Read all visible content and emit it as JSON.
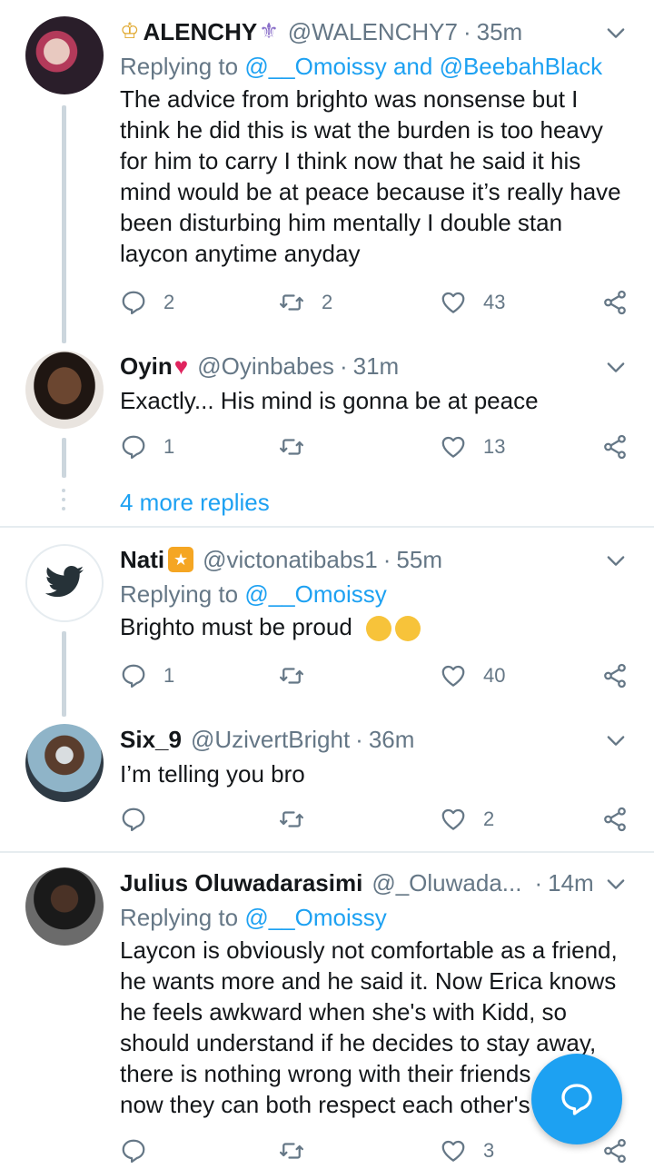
{
  "tweets": [
    {
      "name": "ALENCHY",
      "handle": "@WALENCHY7",
      "time": "35m",
      "replying_prefix": "Replying to ",
      "replying_mentions": "@__Omoissy and @BeebahBlack",
      "text": "The advice from brighto was nonsense but I think he did this is wat the burden is too heavy for him to carry I think now that he said it his mind would be at peace because it’s really have been disturbing him mentally I double stan laycon anytime anyday",
      "replies": "2",
      "retweets": "2",
      "likes": "43"
    },
    {
      "name": "Oyin",
      "handle": "@Oyinbabes",
      "time": "31m",
      "text": "Exactly... His mind is gonna be at peace",
      "replies": "1",
      "retweets": "",
      "likes": "13"
    },
    {
      "name": "Nati",
      "handle": "@victonatibabs1",
      "time": "55m",
      "replying_prefix": "Replying to ",
      "replying_mentions": "@__Omoissy",
      "text": "Brighto must be proud",
      "replies": "1",
      "retweets": "",
      "likes": "40"
    },
    {
      "name": "Six_9",
      "handle": "@UzivertBright",
      "time": "36m",
      "text": "I’m telling you bro",
      "replies": "",
      "retweets": "",
      "likes": "2"
    },
    {
      "name": "Julius Oluwadarasimi",
      "handle": "@_Oluwada...",
      "time": "14m",
      "replying_prefix": "Replying to ",
      "replying_mentions": "@__Omoissy",
      "text_lines": [
        "Laycon is obviously not comfortable as a friend,",
        "he wants more and he said it. Now Erica knows",
        "he feels awkward when she's with Kidd, so",
        "should understand if he decides to stay away,",
        "there is nothing wrong with their friends",
        "now they can both respect each other's"
      ],
      "replies": "",
      "retweets": "",
      "likes": "3"
    }
  ],
  "more_replies": "4 more replies",
  "separator": "·",
  "colors": {
    "accent": "#1da1f2",
    "muted": "#657786",
    "line": "#ccd6dd",
    "heart": "#e0245e"
  },
  "icons": [
    "chevron-down-icon",
    "reply-icon",
    "retweet-icon",
    "heart-icon",
    "share-icon",
    "compose-reply-icon"
  ]
}
